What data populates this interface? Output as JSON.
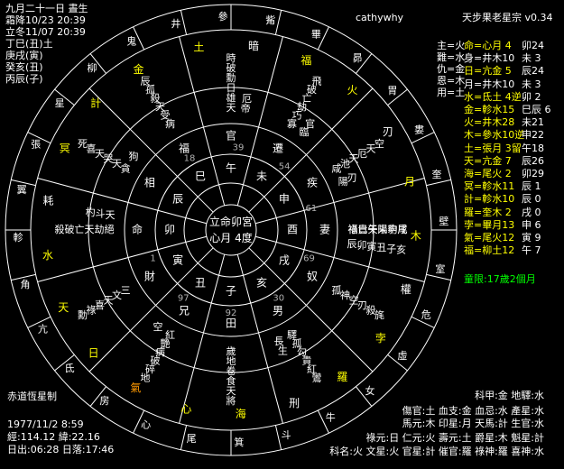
{
  "header": {
    "lunar_date": "九月二十一日 晝生",
    "frost": "霜降10/23 20:39",
    "winter": "立冬11/07 20:39",
    "pillars": [
      "丁巳(丑)土",
      "庚戌(寅)",
      "癸亥(丑)",
      "丙辰(子)"
    ],
    "user": "cathywhy",
    "app": "天步果老星宗 v0.34"
  },
  "summary": [
    {
      "label": "主=火"
    },
    {
      "label": "難=水"
    },
    {
      "label": "仇=金"
    },
    {
      "label": "恩=木"
    },
    {
      "label": "用=土"
    }
  ],
  "star_table": [
    {
      "name": "命=心月 4",
      "value": "卯24",
      "color": "yellow"
    },
    {
      "name": "身=井木10",
      "value": "未 3",
      "color": "white"
    },
    {
      "name": "日=亢金 5",
      "value": "辰24",
      "color": "yellow"
    },
    {
      "name": "月=井木10",
      "value": "未 3",
      "color": "white"
    },
    {
      "name": "水=氐土 4逆",
      "value": "卯 2",
      "color": "yellow"
    },
    {
      "name": "金=軫水15",
      "value": "巳辰 6",
      "color": "yellow"
    },
    {
      "name": "火=井木28",
      "value": "未21",
      "color": "yellow"
    },
    {
      "name": "木=參水10逆",
      "value": "申22",
      "color": "yellow"
    },
    {
      "name": "土=張月 3留",
      "value": "午18",
      "color": "yellow"
    },
    {
      "name": "天=亢金 7",
      "value": "辰26",
      "color": "yellow"
    },
    {
      "name": "海=尾火 2",
      "value": "卯29",
      "color": "yellow"
    },
    {
      "name": "冥=軫水11",
      "value": "辰 1",
      "color": "yellow"
    },
    {
      "name": "計=軫水10",
      "value": "辰 0",
      "color": "yellow"
    },
    {
      "name": "羅=奎木 2",
      "value": "戌 0",
      "color": "yellow"
    },
    {
      "name": "孛=畢月13",
      "value": "申 6",
      "color": "yellow"
    },
    {
      "name": "氣=尾火12",
      "value": "寅 9",
      "color": "yellow"
    },
    {
      "name": "福=柳土12",
      "value": "午 7",
      "color": "yellow"
    }
  ],
  "limit": "童限:17歲2個月",
  "bottom_left": {
    "system": "赤道恆星制",
    "datetime": "1977/11/2 8:59",
    "coords": "經:114.12 緯:22.16",
    "sun": "日出:06:28 日落:17:46"
  },
  "bottom_right": [
    "科甲:金 地驛:水",
    "傷官:土 血支:金 血忌:水 產星:水",
    "馬元:木 印星:月 天馬:計 生官:水",
    "祿元:日 仁元:火 壽元:土 爵星:木 魁星:計",
    "科名:火 文星:火 官星:計 催官:羅 祿神:羅 喜神:水"
  ],
  "palaces_inner": [
    "命",
    "財",
    "兄",
    "田",
    "男",
    "奴",
    "妻",
    "疾",
    "遷",
    "官",
    "福",
    "相"
  ],
  "branches": [
    "卯",
    "寅",
    "丑",
    "子",
    "亥",
    "戌",
    "酉",
    "申",
    "未",
    "午",
    "巳",
    "辰"
  ],
  "center": {
    "line1": "立命卯宮",
    "line2": "心月 4度"
  },
  "degrees": [
    "1",
    "97",
    "92",
    "30",
    "69",
    "61",
    "54",
    "39",
    "18"
  ],
  "mansions_outer": [
    "星",
    "柳",
    "鬼",
    "井",
    "參",
    "觜",
    "畢",
    "昴",
    "胃",
    "婁",
    "奎",
    "壁",
    "室",
    "危",
    "虛",
    "女",
    "牛",
    "斗",
    "箕",
    "尾",
    "心",
    "房",
    "氐",
    "亢",
    "角",
    "軫",
    "翼",
    "張"
  ],
  "planet_glyphs": [
    {
      "t": "土",
      "c": "yellow"
    },
    {
      "t": "暗",
      "c": "white"
    },
    {
      "t": "福",
      "c": "yellow"
    },
    {
      "t": "火",
      "c": "yellow"
    },
    {
      "t": "刃",
      "c": "white"
    },
    {
      "t": "月",
      "c": "yellow"
    },
    {
      "t": "木",
      "c": "yellow"
    },
    {
      "t": "權",
      "c": "white"
    },
    {
      "t": "孛",
      "c": "yellow"
    },
    {
      "t": "羅",
      "c": "yellow"
    },
    {
      "t": "刑",
      "c": "white"
    },
    {
      "t": "海",
      "c": "yellow"
    },
    {
      "t": "心",
      "c": "yellow"
    },
    {
      "t": "氣",
      "c": "orange"
    },
    {
      "t": "日",
      "c": "yellow"
    },
    {
      "t": "天",
      "c": "yellow"
    },
    {
      "t": "水",
      "c": "yellow"
    },
    {
      "t": "耗",
      "c": "white"
    },
    {
      "t": "冥",
      "c": "yellow"
    },
    {
      "t": "計",
      "c": "yellow"
    },
    {
      "t": "金",
      "c": "yellow"
    }
  ],
  "spirit_clusters": [
    "祿 貴 天 陽 豹 尾",
    "孤 神 空 刃 殺 旄",
    "驛 孤 勾 貴 紅 鸞 長 生",
    "歲 地 卷 食 天 將",
    "紅 艷 病 破 碎 地 空",
    "三 文 天 喜 祿 勳",
    "絕 劫 天 亡 破 殺 天 斗 杓",
    "貪 天 哭 天 喜 死 狗",
    "病 受 天 殺 孤 辰",
    "天 雄 日 勳 破 時 帝 厄",
    "寡 巧 劫 亡 破 飛 臨 官",
    "咸 池 天 厄 天 空 陽 刃",
    "福 巳 午 未 申 戌 辰 卯 寅 丑 子 亥"
  ],
  "colors": {
    "background": "#000000",
    "text": "#ffffff",
    "accent": "#ffff00",
    "red": "#ff3030",
    "green": "#00ff00",
    "orange": "#ff9900"
  }
}
